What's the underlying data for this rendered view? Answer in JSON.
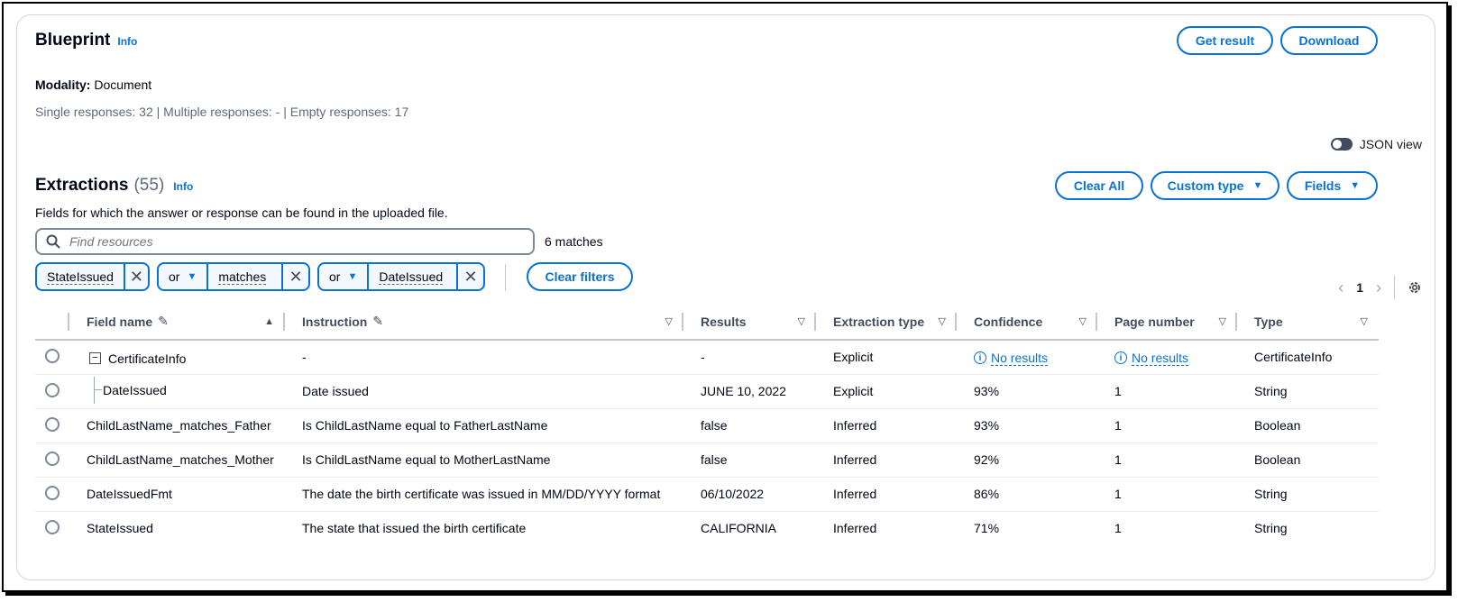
{
  "header": {
    "title": "Blueprint",
    "info": "Info",
    "get_result": "Get result",
    "download": "Download"
  },
  "modality": {
    "label": "Modality:",
    "value": "Document"
  },
  "summary": "Single responses: 32 | Multiple responses: - | Empty responses: 17",
  "json_view": "JSON view",
  "extractions": {
    "title": "Extractions",
    "count": "(55)",
    "info": "Info",
    "description": "Fields for which the answer or response can be found in the uploaded file.",
    "clear_all": "Clear All",
    "custom_type": "Custom type",
    "fields": "Fields"
  },
  "search": {
    "placeholder": "Find resources",
    "matches": "6 matches"
  },
  "filters": {
    "token1": "StateIssued",
    "token2_op": "or",
    "token2": "matches",
    "token3_op": "or",
    "token3": "DateIssued",
    "clear_filters": "Clear filters"
  },
  "pagination": {
    "page": "1"
  },
  "table": {
    "headers": [
      "Field name",
      "Instruction",
      "Results",
      "Extraction type",
      "Confidence",
      "Page number",
      "Type"
    ],
    "rows": [
      {
        "field": "CertificateInfo",
        "instruction": "-",
        "results": "-",
        "extraction": "Explicit",
        "confidence": "No results",
        "page": "No results",
        "type": "CertificateInfo"
      },
      {
        "field": "DateIssued",
        "instruction": "Date issued",
        "results": "JUNE 10, 2022",
        "extraction": "Explicit",
        "confidence": "93%",
        "page": "1",
        "type": "String"
      },
      {
        "field": "ChildLastName_matches_Father",
        "instruction": "Is ChildLastName equal to FatherLastName",
        "results": "false",
        "extraction": "Inferred",
        "confidence": "93%",
        "page": "1",
        "type": "Boolean"
      },
      {
        "field": "ChildLastName_matches_Mother",
        "instruction": "Is ChildLastName equal to MotherLastName",
        "results": "false",
        "extraction": "Inferred",
        "confidence": "92%",
        "page": "1",
        "type": "Boolean"
      },
      {
        "field": "DateIssuedFmt",
        "instruction": "The date the birth certificate was issued in MM/DD/YYYY format",
        "results": "06/10/2022",
        "extraction": "Inferred",
        "confidence": "86%",
        "page": "1",
        "type": "String"
      },
      {
        "field": "StateIssued",
        "instruction": "The state that issued the birth certificate",
        "results": "CALIFORNIA",
        "extraction": "Inferred",
        "confidence": "71%",
        "page": "1",
        "type": "String"
      }
    ]
  },
  "colors": {
    "accent": "#0972d3",
    "text": "#000716",
    "muted": "#5f6b7a"
  }
}
